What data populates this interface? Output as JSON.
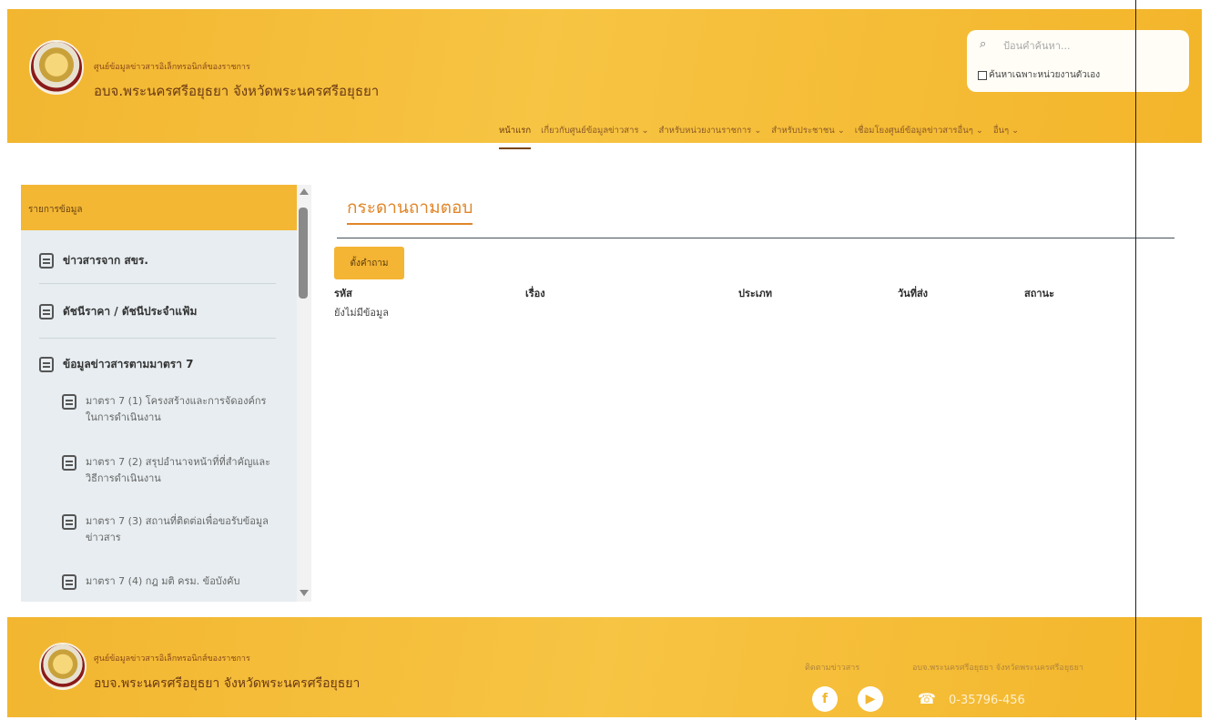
{
  "colors": {
    "header": "#f2b630",
    "accent": "#e0862a",
    "sidebar": "#e7edf0"
  },
  "header": {
    "brand_small": "ศูนย์ข้อมูลข่าวสารอิเล็กทรอนิกส์ของราชการ",
    "brand_big": "อบจ.พระนครศรีอยุธยา จังหวัดพระนครศรีอยุธยา",
    "search_placeholder": "ป้อนคำค้นหา...",
    "own_unit_label": "ค้นหาเฉพาะหน่วยงานตัวเอง",
    "nav": [
      {
        "label": "หน้าแรก",
        "icon": ""
      },
      {
        "label": "เกี่ยวกับศูนย์ข้อมูลข่าวสาร",
        "icon": "chevron-down-icon"
      },
      {
        "label": "สำหรับหน่วยงานราชการ",
        "icon": "chevron-down-icon"
      },
      {
        "label": "สำหรับประชาชน",
        "icon": "chevron-down-icon"
      },
      {
        "label": "เชื่อมโยงศูนย์ข้อมูลข่าวสารอื่นๆ",
        "icon": "chevron-down-icon"
      },
      {
        "label": "อื่นๆ",
        "icon": "chevron-down-icon"
      }
    ]
  },
  "sidebar": {
    "heading": "รายการข้อมูล",
    "items": [
      {
        "label": "ข่าวสารจาก สขร."
      },
      {
        "label": "ดัชนีราคา / ดัชนีประจำแฟ้ม"
      },
      {
        "label": "ข้อมูลข่าวสารตามมาตรา 7"
      }
    ],
    "sub_items": [
      {
        "label": "มาตรา 7 (1) โครงสร้างและการจัดองค์กรในการดำเนินงาน"
      },
      {
        "label": "มาตรา 7 (2) สรุปอำนาจหน้าที่ที่สำคัญและวิธีการดำเนินงาน"
      },
      {
        "label": "มาตรา 7 (3) สถานที่ติดต่อเพื่อขอรับข้อมูลข่าวสาร"
      },
      {
        "label": "มาตรา 7 (4) กฎ มติ ครม. ข้อบังคับ"
      }
    ]
  },
  "main": {
    "title": "กระดานถามตอบ",
    "ask_button": "ตั้งคำถาม",
    "columns": [
      "รหัส",
      "เรื่อง",
      "ประเภท",
      "วันที่ส่ง",
      "สถานะ"
    ],
    "empty_text": "ยังไม่มีข้อมูล"
  },
  "footer": {
    "brand_small": "ศูนย์ข้อมูลข่าวสารอิเล็กทรอนิกส์ของราชการ",
    "brand_big": "อบจ.พระนครศรีอยุธยา จังหวัดพระนครศรีอยุธยา",
    "follow_label": "ติดตามข่าวสาร",
    "org_label": "อบจ.พระนครศรีอยุธยา จังหวัดพระนครศรีอยุธยา",
    "phone": "0-35796-456"
  }
}
